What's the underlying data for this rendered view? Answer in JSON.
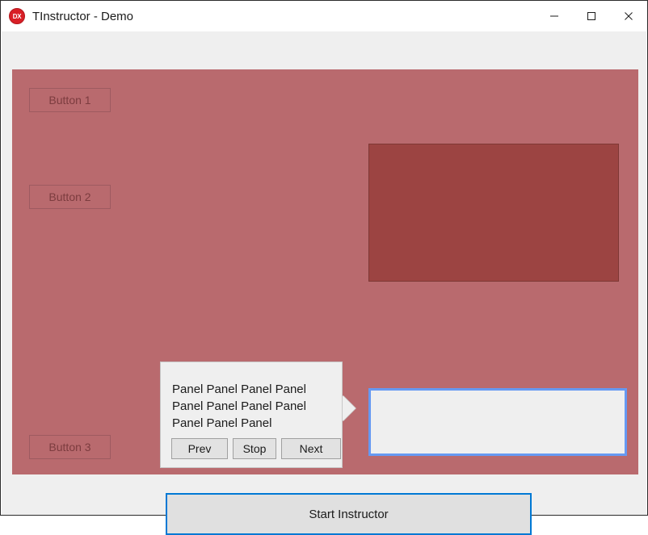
{
  "window": {
    "title": "TInstructor - Demo",
    "icon_label": "DX",
    "icon_name": "devexpress-logo-icon",
    "controls": [
      {
        "name": "minimize-button",
        "label": "Minimize"
      },
      {
        "name": "maximize-button",
        "label": "Maximize"
      },
      {
        "name": "close-button",
        "label": "Close"
      }
    ]
  },
  "colors": {
    "overlay": "#b96a6e",
    "overlay_panel": "#9c4442",
    "highlight_border": "#6699f2",
    "focus_border": "#0078d4",
    "client_background": "#efefef",
    "callout_background": "#efefef",
    "button_face": "#e2e2e2",
    "title_bar": "#ffffff"
  },
  "form": {
    "dim_buttons": [
      {
        "name": "button-1",
        "label": "Button 1"
      },
      {
        "name": "button-2",
        "label": "Button 2"
      },
      {
        "name": "button-3",
        "label": "Button 3"
      }
    ],
    "dim_panel": {
      "name": "dimmed-panel",
      "label": ""
    },
    "highlight_panel": {
      "name": "highlighted-panel",
      "label": ""
    },
    "start_button": {
      "name": "start-instructor-button",
      "label": "Start Instructor"
    }
  },
  "callout": {
    "text": "Panel Panel Panel Panel Panel Panel Panel Panel Panel Panel Panel",
    "buttons": {
      "prev": "Prev",
      "stop": "Stop",
      "next": "Next"
    }
  }
}
